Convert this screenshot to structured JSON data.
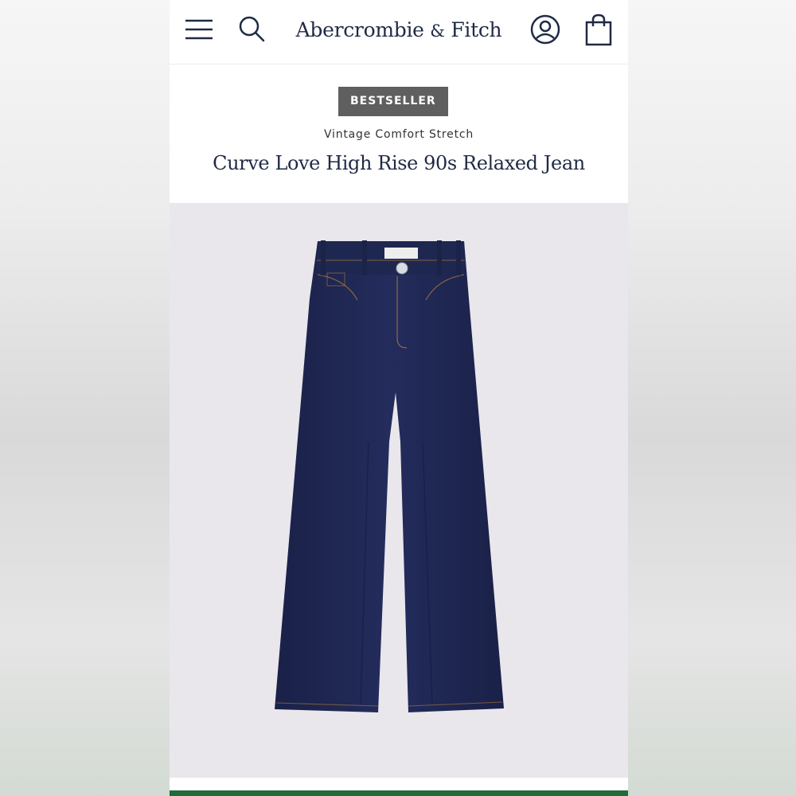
{
  "header": {
    "brand_name": "Abercrombie",
    "brand_amp": "&",
    "brand_suffix": "Fitch",
    "icons": [
      "menu-icon",
      "search-icon",
      "account-icon",
      "shopping-bag-icon"
    ]
  },
  "product": {
    "badge": "BESTSELLER",
    "collection": "Vintage Comfort Stretch",
    "title": "Curve Love High Rise 90s Relaxed Jean",
    "image": "dark-wash-jeans"
  },
  "colors": {
    "brand_navy": "#1f2a44",
    "badge_bg": "#5f5f5f",
    "image_bg": "#e9e7ec",
    "denim": "#1c2550",
    "stitch": "#b07a3a",
    "bottom_bar": "#1f6b3a"
  }
}
